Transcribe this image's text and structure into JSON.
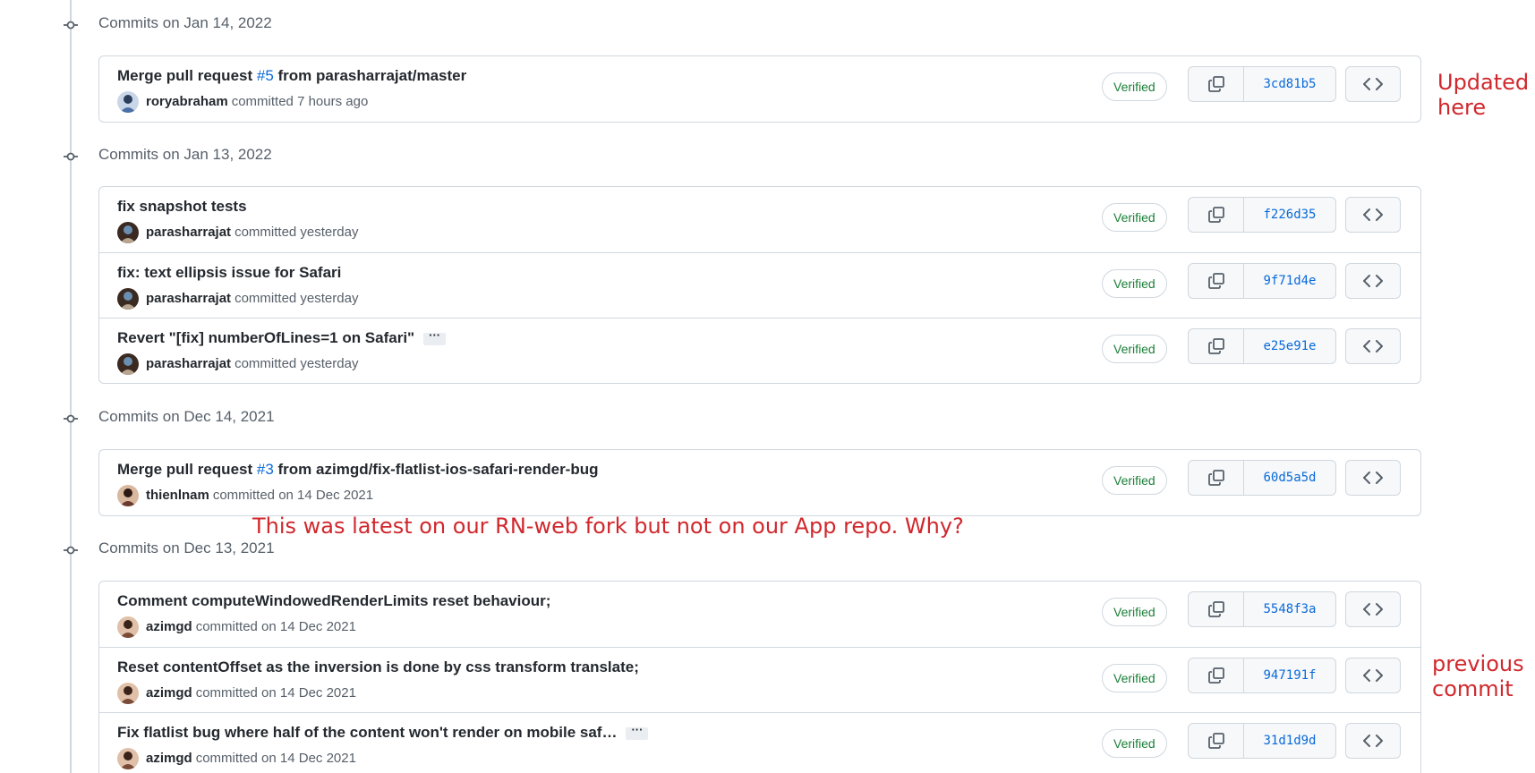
{
  "groups": [
    {
      "title": "Commits on Jan 14, 2022",
      "commits": [
        {
          "msg_pre": "Merge pull request ",
          "pr": "#5",
          "msg_post": " from parasharrajat/master",
          "author": "roryabraham",
          "when": "committed 7 hours ago",
          "verified": "Verified",
          "sha": "3cd81b5"
        }
      ]
    },
    {
      "title": "Commits on Jan 13, 2022",
      "commits": [
        {
          "msg_pre": "fix snapshot tests",
          "author": "parasharrajat",
          "when": "committed yesterday",
          "verified": "Verified",
          "sha": "f226d35"
        },
        {
          "msg_pre": "fix: text ellipsis issue for Safari",
          "author": "parasharrajat",
          "when": "committed yesterday",
          "verified": "Verified",
          "sha": "9f71d4e"
        },
        {
          "msg_pre": "Revert \"[fix] numberOfLines=1 on Safari\"",
          "ellipsis": "···",
          "author": "parasharrajat",
          "when": "committed yesterday",
          "verified": "Verified",
          "sha": "e25e91e"
        }
      ]
    },
    {
      "title": "Commits on Dec 14, 2021",
      "commits": [
        {
          "msg_pre": "Merge pull request ",
          "pr": "#3",
          "msg_post": " from azimgd/fix-flatlist-ios-safari-render-bug",
          "author": "thienlnam",
          "when": "committed on 14 Dec 2021",
          "verified": "Verified",
          "sha": "60d5a5d"
        }
      ]
    },
    {
      "title": "Commits on Dec 13, 2021",
      "commits": [
        {
          "msg_pre": "Comment computeWindowedRenderLimits reset behaviour;",
          "author": "azimgd",
          "when": "committed on 14 Dec 2021",
          "verified": "Verified",
          "sha": "5548f3a"
        },
        {
          "msg_pre": "Reset contentOffset as the inversion is done by css transform translate;",
          "author": "azimgd",
          "when": "committed on 14 Dec 2021",
          "verified": "Verified",
          "sha": "947191f"
        },
        {
          "msg_pre": "Fix flatlist bug where half of the content won't render on mobile saf…",
          "ellipsis": "···",
          "author": "azimgd",
          "when": "committed on 14 Dec 2021",
          "verified": "Verified",
          "sha": "31d1d9d"
        }
      ]
    }
  ],
  "annotations": {
    "updated_here_1": "Updated",
    "updated_here_2": "here",
    "latest_note": "This was latest on our RN-web fork but not on our App repo. Why?",
    "previous_commit_1": "previous",
    "previous_commit_2": "commit"
  },
  "colors": {
    "verified": "#1a7f37",
    "link": "#0969da",
    "annotation": "#d0282d"
  },
  "icons": {
    "group": "git-commit-icon",
    "copy": "copy-icon",
    "browse": "code-icon",
    "avatar": "user-avatar"
  }
}
